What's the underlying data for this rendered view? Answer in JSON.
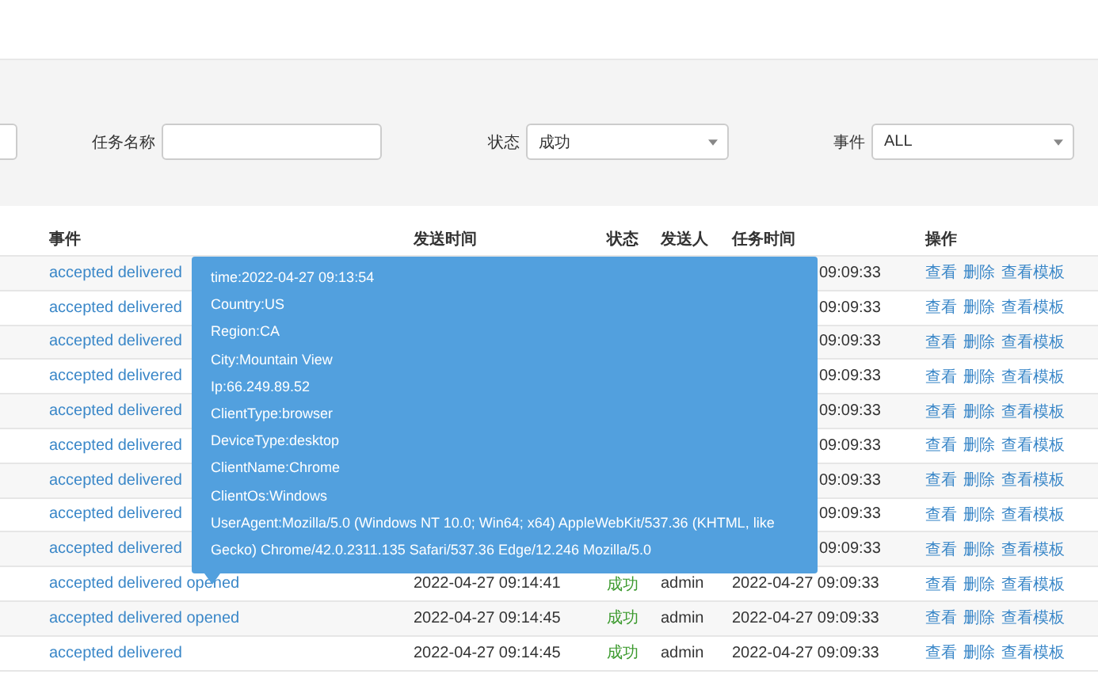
{
  "filters": [
    {
      "kind": "text"
    },
    {
      "kind": "text",
      "label": "任务名称"
    },
    {
      "kind": "select",
      "label": "状态",
      "value": "成功"
    },
    {
      "kind": "select",
      "label": "事件",
      "value": "ALL"
    }
  ],
  "table": {
    "columns": [
      "事件",
      "发送时间",
      "状态",
      "发送人",
      "任务时间",
      "操作"
    ],
    "rows": [
      {
        "event": "accepted delivered",
        "task_time": "09:09:33",
        "actions": [
          "查看",
          "删除",
          "查看模板"
        ]
      },
      {
        "event": "accepted delivered",
        "task_time": "09:09:33",
        "actions": [
          "查看",
          "删除",
          "查看模板"
        ]
      },
      {
        "event": "accepted delivered",
        "task_time": "09:09:33",
        "actions": [
          "查看",
          "删除",
          "查看模板"
        ]
      },
      {
        "event": "accepted delivered",
        "task_time": "09:09:33",
        "actions": [
          "查看",
          "删除",
          "查看模板"
        ]
      },
      {
        "event": "accepted delivered",
        "task_time": "09:09:33",
        "actions": [
          "查看",
          "删除",
          "查看模板"
        ]
      },
      {
        "event": "accepted delivered",
        "task_time": "09:09:33",
        "actions": [
          "查看",
          "删除",
          "查看模板"
        ]
      },
      {
        "event": "accepted delivered",
        "task_time": "09:09:33",
        "actions": [
          "查看",
          "删除",
          "查看模板"
        ]
      },
      {
        "event": "accepted delivered",
        "task_time": "09:09:33",
        "actions": [
          "查看",
          "删除",
          "查看模板"
        ]
      },
      {
        "event": "accepted delivered",
        "task_time": "09:09:33",
        "actions": [
          "查看",
          "删除",
          "查看模板"
        ]
      },
      {
        "event": "accepted delivered opened",
        "send_time": "2022-04-27 09:14:41",
        "status": "成功",
        "sender": "admin",
        "task_time": "2022-04-27 09:09:33",
        "actions": [
          "查看",
          "删除",
          "查看模板"
        ]
      },
      {
        "event": "accepted delivered opened",
        "send_time": "2022-04-27 09:14:45",
        "status": "成功",
        "sender": "admin",
        "task_time": "2022-04-27 09:09:33",
        "actions": [
          "查看",
          "删除",
          "查看模板"
        ]
      },
      {
        "event": "accepted delivered",
        "send_time": "2022-04-27 09:14:45",
        "status": "成功",
        "sender": "admin",
        "task_time": "2022-04-27 09:09:33",
        "actions": [
          "查看",
          "删除",
          "查看模板"
        ]
      }
    ]
  },
  "tooltip": {
    "lines": [
      "time:2022-04-27 09:13:54",
      "Country:US",
      "Region:CA",
      "City:Mountain View",
      "Ip:66.249.89.52",
      "ClientType:browser",
      "DeviceType:desktop",
      "ClientName:Chrome",
      "ClientOs:Windows",
      "UserAgent:Mozilla/5.0 (Windows NT 10.0; Win64; x64) AppleWebKit/537.36 (KHTML, like Gecko) Chrome/42.0.2311.135 Safari/537.36 Edge/12.246 Mozilla/5.0"
    ]
  }
}
